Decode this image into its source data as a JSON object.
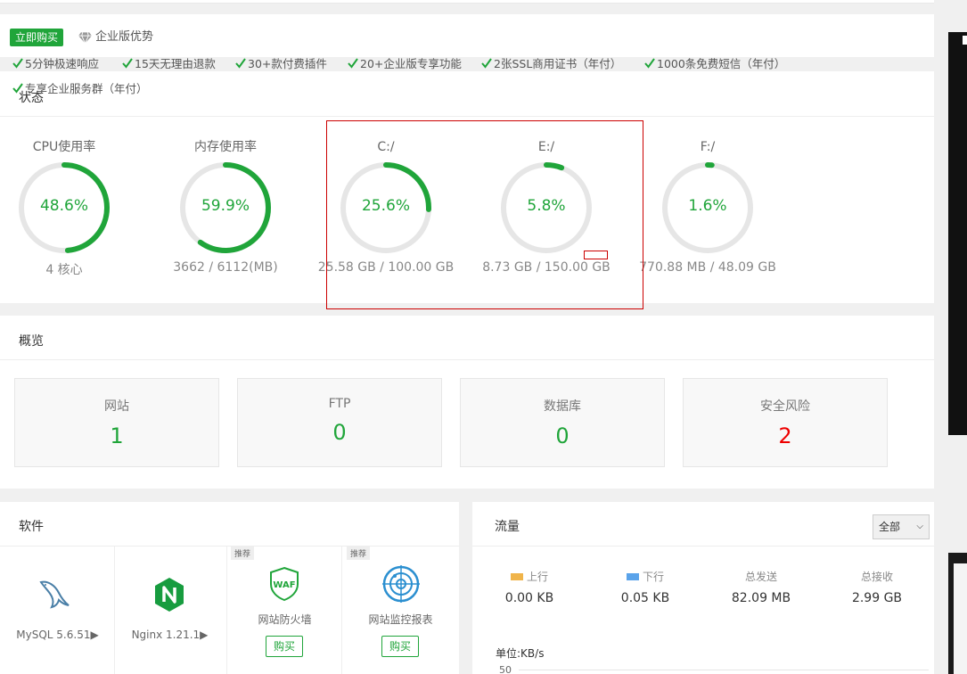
{
  "promo": {
    "buy_label": "立即购买",
    "enterprise_label": "企业版优势",
    "features": [
      "5分钟极速响应",
      "15天无理由退款",
      "30+款付费插件",
      "20+企业版专享功能",
      "2张SSL商用证书（年付）",
      "1000条免费短信（年付）",
      "专享企业服务群（年付）"
    ],
    "accent": "#20a53a"
  },
  "status": {
    "title": "状态",
    "gauges": [
      {
        "label": "CPU使用率",
        "percent_text": "48.6%",
        "value": 48.6,
        "sub": "4 核心"
      },
      {
        "label": "内存使用率",
        "percent_text": "59.9%",
        "value": 59.9,
        "sub": "3662 / 6112(MB)"
      },
      {
        "label": "C:/",
        "percent_text": "25.6%",
        "value": 25.6,
        "sub": "25.58 GB / 100.00 GB"
      },
      {
        "label": "E:/",
        "percent_text": "5.8%",
        "value": 5.8,
        "sub": "8.73 GB / 150.00 GB"
      },
      {
        "label": "F:/",
        "percent_text": "1.6%",
        "value": 1.6,
        "sub": "770.88 MB / 48.09 GB"
      }
    ]
  },
  "overview": {
    "title": "概览",
    "boxes": [
      {
        "label": "网站",
        "value": "1"
      },
      {
        "label": "FTP",
        "value": "0"
      },
      {
        "label": "数据库",
        "value": "0"
      },
      {
        "label": "安全风险",
        "value": "2"
      }
    ]
  },
  "software": {
    "title": "软件",
    "items": [
      {
        "name": "MySQL 5.6.51▶",
        "icon": "mysql-dolphin-icon"
      },
      {
        "name": "Nginx 1.21.1▶",
        "icon": "nginx-icon"
      },
      {
        "name": "网站防火墙",
        "tag": "推荐",
        "buy": "购买",
        "icon": "waf-shield-icon",
        "icon_text": "WAF"
      },
      {
        "name": "网站监控报表",
        "tag": "推荐",
        "buy": "购买",
        "icon": "monitor-radar-icon"
      }
    ]
  },
  "flow": {
    "title": "流量",
    "select_value": "全部",
    "stats": [
      {
        "label": "上行",
        "value": "0.00 KB",
        "color": "#f0b44a"
      },
      {
        "label": "下行",
        "value": "0.05 KB",
        "color": "#5aa3ea"
      },
      {
        "label": "总发送",
        "value": "82.09 MB"
      },
      {
        "label": "总接收",
        "value": "2.99 GB"
      }
    ],
    "unit": "单位:KB/s",
    "axis_top": "50"
  }
}
